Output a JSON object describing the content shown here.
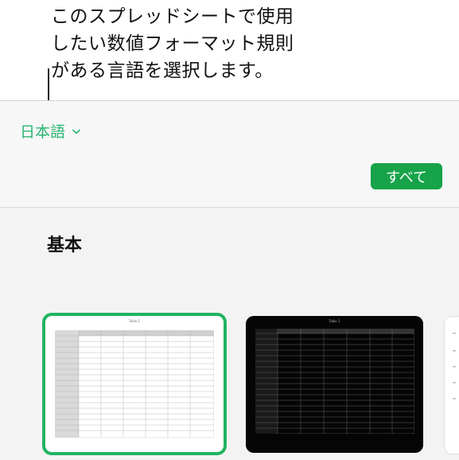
{
  "callout": {
    "lines": [
      "このスプレッドシートで使用",
      "したい数値フォーマット規則",
      "がある言語を選択します。"
    ]
  },
  "header": {
    "language_label": "日本語",
    "all_button_label": "すべて"
  },
  "main": {
    "section_title": "基本",
    "templates": [
      {
        "title": "Table 1",
        "style": "light",
        "selected": true
      },
      {
        "title": "Table 1",
        "style": "dark",
        "selected": false
      },
      {
        "title": "",
        "style": "light",
        "selected": false
      }
    ]
  },
  "colors": {
    "accent_green": "#2bb673",
    "button_green": "#17a34a",
    "selection_green": "#21b462"
  },
  "icons": {
    "language_chevron": "chevron-down-icon"
  }
}
